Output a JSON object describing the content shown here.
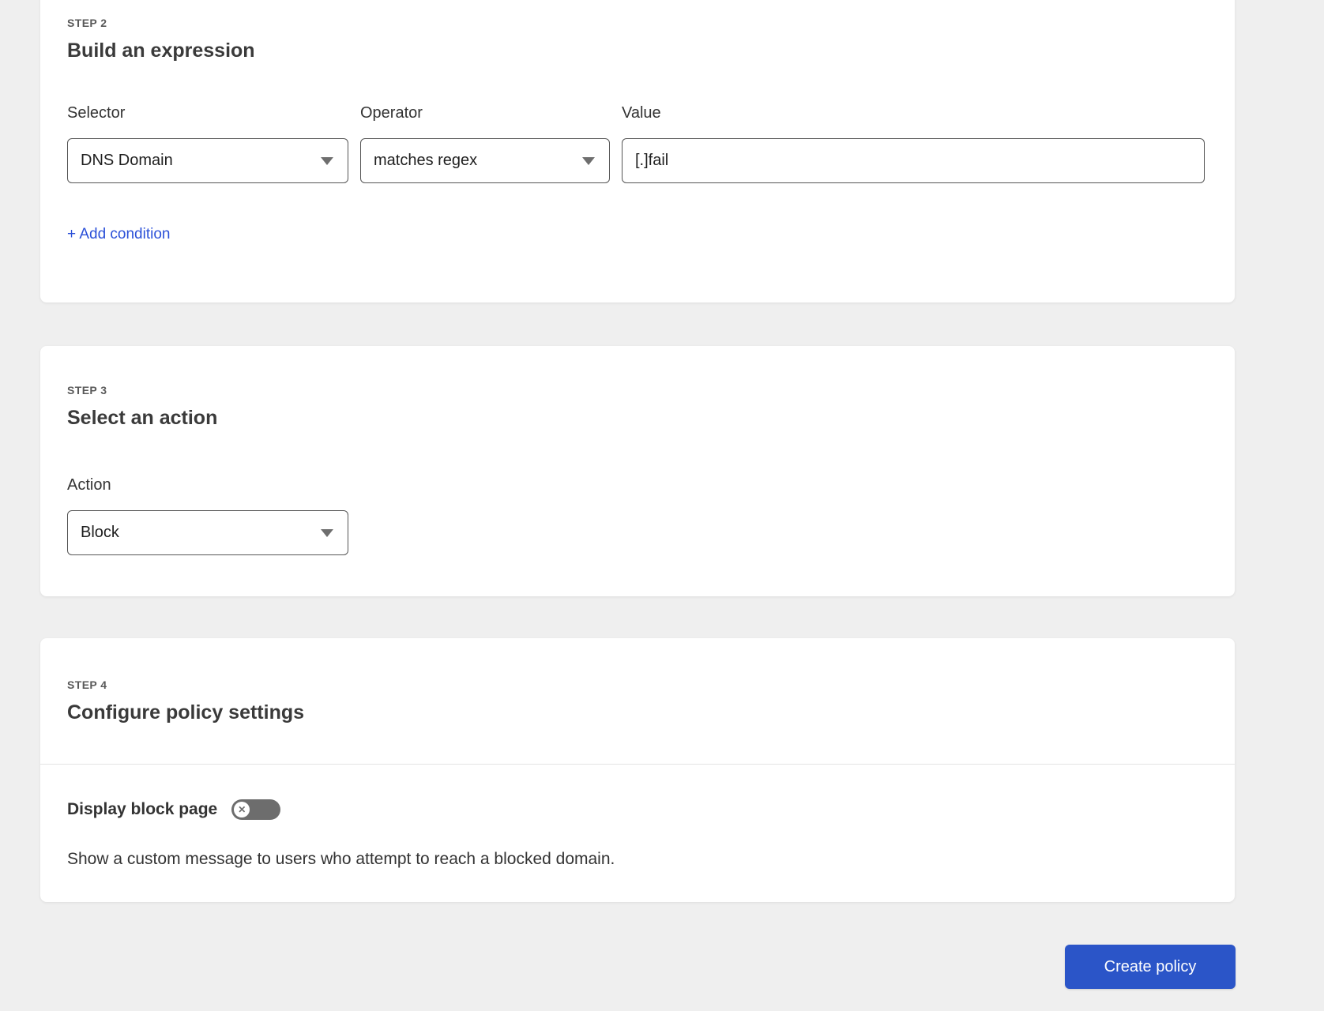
{
  "step2": {
    "step_label": "STEP 2",
    "title": "Build an expression",
    "selector": {
      "label": "Selector",
      "value": "DNS Domain"
    },
    "operator": {
      "label": "Operator",
      "value": "matches regex"
    },
    "value_field": {
      "label": "Value",
      "value": "[.]fail"
    },
    "add_condition_label": "+ Add condition"
  },
  "step3": {
    "step_label": "STEP 3",
    "title": "Select an action",
    "action": {
      "label": "Action",
      "value": "Block"
    }
  },
  "step4": {
    "step_label": "STEP 4",
    "title": "Configure policy settings",
    "display_block_page": {
      "label": "Display block page",
      "toggle_state": "off",
      "description": "Show a custom message to users who attempt to reach a blocked domain."
    }
  },
  "footer": {
    "create_policy_label": "Create policy"
  },
  "colors": {
    "page_background": "#efefef",
    "card_background": "#ffffff",
    "input_border": "#555555",
    "link_blue": "#2b50d8",
    "button_blue": "#2b55c8",
    "toggle_off_gray": "#6d6d6d",
    "step_label_gray": "#595959"
  }
}
